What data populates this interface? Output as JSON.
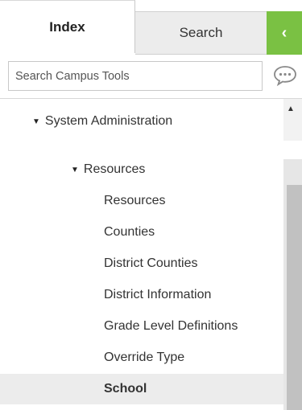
{
  "tabs": {
    "index_label": "Index",
    "search_label": "Search",
    "collapse_glyph": "‹"
  },
  "search": {
    "placeholder": "Search Campus Tools",
    "chat_icon": "chat-bubble-icon"
  },
  "tree": {
    "items": [
      {
        "label": "System Administration",
        "expanded": true
      },
      {
        "label": "Resources",
        "expanded": true
      },
      {
        "label": "Resources"
      },
      {
        "label": "Counties"
      },
      {
        "label": "District Counties"
      },
      {
        "label": "District Information"
      },
      {
        "label": "Grade Level Definitions"
      },
      {
        "label": "Override Type"
      },
      {
        "label": "School",
        "selected": true
      }
    ]
  },
  "colors": {
    "accent_green": "#7ac143",
    "selected_bg": "#ececec"
  }
}
